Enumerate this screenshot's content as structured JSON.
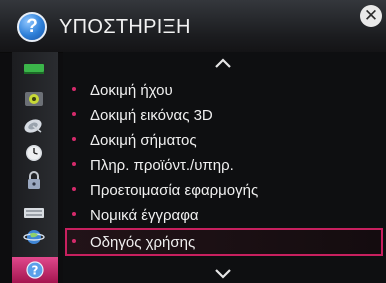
{
  "window": {
    "title": "ΥΠΟΣΤΗΡΙΞΗ",
    "help_glyph": "?",
    "close_glyph": "✕"
  },
  "sidebar": {
    "items": [
      {
        "icon": "picture-icon"
      },
      {
        "icon": "sound-icon"
      },
      {
        "icon": "channel-dish-icon"
      },
      {
        "icon": "clock-icon"
      },
      {
        "icon": "lock-icon"
      },
      {
        "icon": "keyboard-icon"
      },
      {
        "icon": "network-globe-icon"
      },
      {
        "icon": "help-icon",
        "selected": true,
        "glyph": "?"
      }
    ]
  },
  "menu": {
    "items": [
      {
        "label": "Δοκιμή ήχου"
      },
      {
        "label": "Δοκιμή εικόνας 3D"
      },
      {
        "label": "Δοκιμή σήματος"
      },
      {
        "label": "Πληρ. προϊόντ./υπηρ."
      },
      {
        "label": "Προετοιμασία εφαρμογής"
      },
      {
        "label": "Νομικά έγγραφα"
      },
      {
        "label": "Οδηγός χρήσης",
        "focused": true
      }
    ]
  },
  "colors": {
    "accent": "#c8205f",
    "bullet": "#d42a6b",
    "background": "#0d0d0f",
    "text": "#f0f0f0"
  }
}
